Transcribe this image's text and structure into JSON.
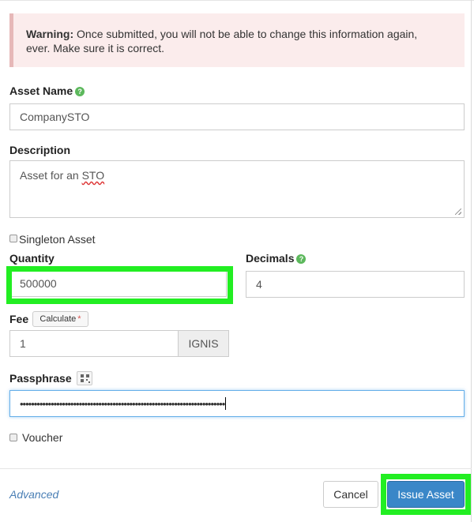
{
  "warning": {
    "strong": "Warning:",
    "line1": " Once submitted, you will not be able to change this information again,",
    "line2": "ever. Make sure it is correct."
  },
  "asset_name": {
    "label": "Asset Name",
    "value": "CompanySTO"
  },
  "description": {
    "label": "Description",
    "value_prefix": "Asset for an ",
    "value_flagged": "STO"
  },
  "singleton": {
    "label": "Singleton Asset",
    "checked": false
  },
  "quantity": {
    "label": "Quantity",
    "value": "500000"
  },
  "decimals": {
    "label": "Decimals",
    "value": "4"
  },
  "fee": {
    "label": "Fee",
    "calculate_label": "Calculate",
    "required_mark": "*",
    "value": "1",
    "unit": "IGNIS"
  },
  "passphrase": {
    "label": "Passphrase",
    "masked_value": "•••••••••••••••••••••••••••••••••••••••••••••••••••••••••••••••••••••••••"
  },
  "voucher": {
    "label": "Voucher",
    "checked": false
  },
  "footer": {
    "advanced_label": "Advanced",
    "cancel_label": "Cancel",
    "submit_label": "Issue Asset"
  },
  "colors": {
    "highlight": "#22ee22",
    "primary": "#3a87c8",
    "warning_bg": "#fbecec",
    "help_icon": "#5cb85c"
  }
}
